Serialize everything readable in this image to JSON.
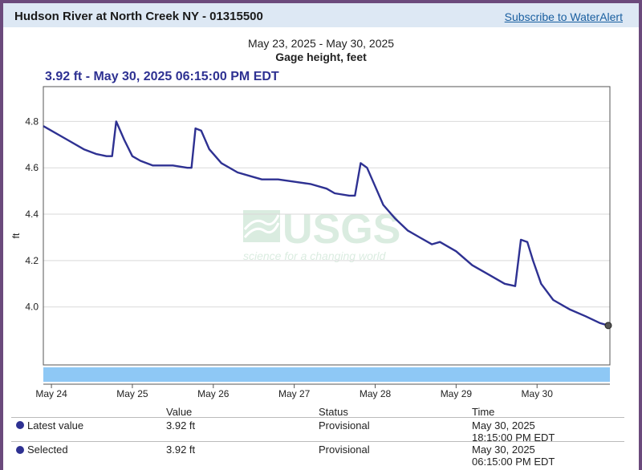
{
  "header": {
    "title": "Hudson River at North Creek NY - 01315500",
    "subscribe_label": "Subscribe to WaterAlert"
  },
  "readout": "3.92 ft - May 30, 2025 06:15:00 PM EDT",
  "watermark": {
    "logo_text": "USGS",
    "tagline": "science for a changing world"
  },
  "chart_data": {
    "type": "line",
    "title": "May 23, 2025 - May 30, 2025",
    "subtitle": "Gage height, feet",
    "ylabel": "ft",
    "xlabel": "",
    "xlim": [
      0,
      7.0
    ],
    "ylim": [
      3.75,
      4.95
    ],
    "y_ticks": [
      4.0,
      4.2,
      4.4,
      4.6,
      4.8
    ],
    "x_ticks": [
      {
        "label": "May 24",
        "x": 0.1
      },
      {
        "label": "May 25",
        "x": 1.1
      },
      {
        "label": "May 26",
        "x": 2.1
      },
      {
        "label": "May 27",
        "x": 3.1
      },
      {
        "label": "May 28",
        "x": 4.1
      },
      {
        "label": "May 29",
        "x": 5.1
      },
      {
        "label": "May 30",
        "x": 6.1
      }
    ],
    "grid": true,
    "color": "#2e3192",
    "series": [
      {
        "name": "",
        "x": [
          0.0,
          0.3,
          0.5,
          0.65,
          0.78,
          0.85,
          0.9,
          1.0,
          1.1,
          1.2,
          1.35,
          1.45,
          1.6,
          1.78,
          1.83,
          1.88,
          1.95,
          2.05,
          2.2,
          2.4,
          2.6,
          2.7,
          2.9,
          3.1,
          3.3,
          3.5,
          3.6,
          3.78,
          3.85,
          3.92,
          4.0,
          4.1,
          4.2,
          4.35,
          4.5,
          4.65,
          4.8,
          4.9,
          5.1,
          5.3,
          5.5,
          5.7,
          5.83,
          5.9,
          5.98,
          6.05,
          6.15,
          6.3,
          6.5,
          6.7,
          6.88,
          6.98
        ],
        "y": [
          4.78,
          4.72,
          4.68,
          4.66,
          4.65,
          4.65,
          4.8,
          4.72,
          4.65,
          4.63,
          4.61,
          4.61,
          4.61,
          4.6,
          4.6,
          4.77,
          4.76,
          4.68,
          4.62,
          4.58,
          4.56,
          4.55,
          4.55,
          4.54,
          4.53,
          4.51,
          4.49,
          4.48,
          4.48,
          4.62,
          4.6,
          4.52,
          4.44,
          4.38,
          4.33,
          4.3,
          4.27,
          4.28,
          4.24,
          4.18,
          4.14,
          4.1,
          4.09,
          4.29,
          4.28,
          4.2,
          4.1,
          4.03,
          3.99,
          3.96,
          3.93,
          3.92
        ]
      }
    ]
  },
  "table": {
    "headers": {
      "value": "Value",
      "status": "Status",
      "time": "Time"
    },
    "rows": [
      {
        "label": "Latest value",
        "value": "3.92 ft",
        "status": "Provisional",
        "time_date": "May 30, 2025",
        "time_clock": "18:15:00 PM EDT"
      },
      {
        "label": "Selected",
        "value": "3.92 ft",
        "status": "Provisional",
        "time_date": "May 30, 2025",
        "time_clock": "06:15:00 PM EDT"
      }
    ]
  }
}
